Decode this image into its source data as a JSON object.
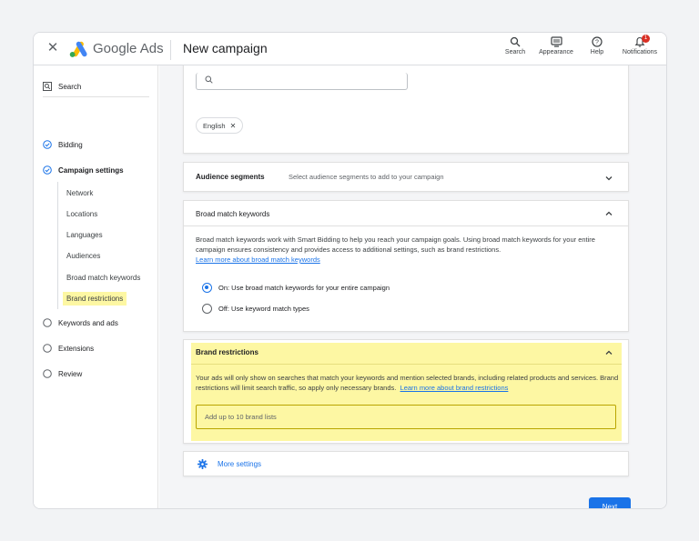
{
  "header": {
    "brand_google": "Google",
    "brand_ads": "Ads",
    "page_title": "New campaign",
    "tools": {
      "search": "Search",
      "appearance": "Appearance",
      "help": "Help",
      "notifications": "Notifications"
    },
    "notification_count": "1"
  },
  "sidebar": {
    "search": "Search",
    "bidding": "Bidding",
    "campaign_settings": "Campaign settings",
    "subitems": {
      "network": "Network",
      "locations": "Locations",
      "languages": "Languages",
      "audiences": "Audiences",
      "broad_match": "Broad match keywords",
      "brand_restrictions": "Brand restrictions"
    },
    "keywords_ads": "Keywords and ads",
    "extensions": "Extensions",
    "review": "Review"
  },
  "languages": {
    "chip": "English"
  },
  "audience": {
    "title": "Audience segments",
    "hint": "Select audience segments to add to your campaign"
  },
  "broad_match": {
    "title": "Broad match keywords",
    "description": "Broad match keywords work with Smart Bidding to help you reach your campaign goals. Using broad match keywords for your entire campaign ensures consistency and provides access to additional settings, such as brand restrictions.",
    "link": "Learn more about broad match keywords",
    "option_on": "On: Use broad match keywords for your entire campaign",
    "option_off": "Off: Use keyword match types"
  },
  "brand_restrictions": {
    "title": "Brand restrictions",
    "description": "Your ads will only show on searches that match your keywords and mention selected brands, including related products and services. Brand restrictions will limit search traffic, so apply only necessary brands.",
    "link": "Learn more about brand restrictions",
    "placeholder": "Add up to 10 brand lists"
  },
  "more_settings": "More settings",
  "next": "Next",
  "colors": {
    "accent": "#1a73e8",
    "highlight": "#fdf7a3"
  }
}
